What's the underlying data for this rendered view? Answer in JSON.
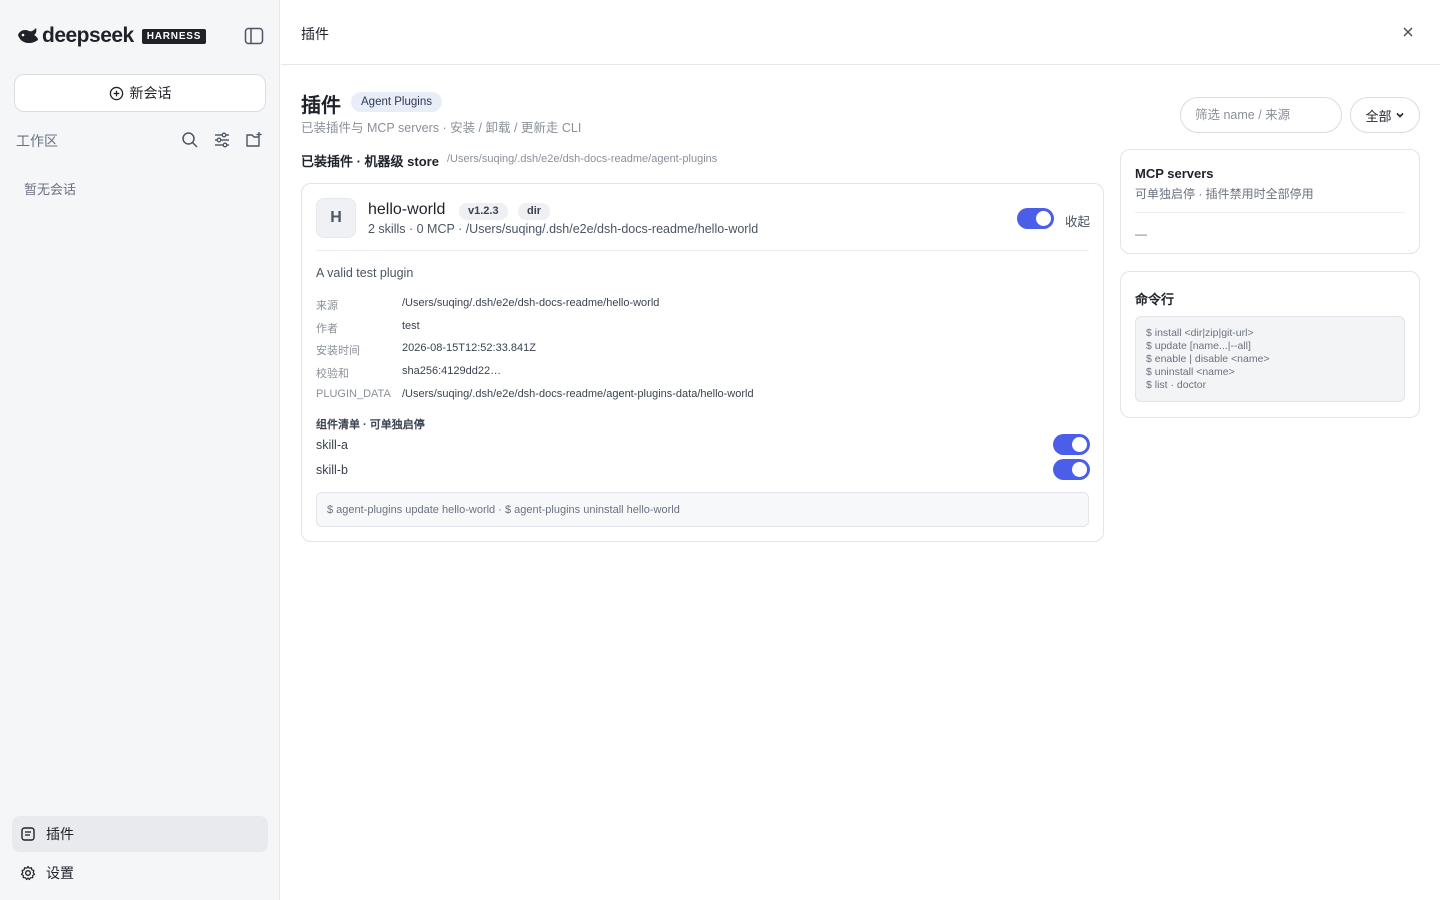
{
  "brand": {
    "name": "deepseek",
    "tag": "HARNESS"
  },
  "sidebar": {
    "new_chat": "新会话",
    "workspace_label": "工作区",
    "empty_text": "暂无会话",
    "nav": [
      {
        "label": "插件",
        "icon": "plugin-icon",
        "active": true
      },
      {
        "label": "设置",
        "icon": "gear-icon",
        "active": false
      }
    ]
  },
  "topbar": {
    "title": "插件"
  },
  "page": {
    "title": "插件",
    "badge": "Agent Plugins",
    "subtitle": "已装插件与 MCP servers · 安装 / 卸载 / 更新走 CLI",
    "filter_placeholder": "筛选 name / 来源",
    "filter_select": "全部",
    "section_label": "已装插件 · 机器级 store",
    "section_path": "/Users/suqing/.dsh/e2e/dsh-docs-readme/agent-plugins"
  },
  "plugin": {
    "avatar": "H",
    "name": "hello-world",
    "version": "v1.2.3",
    "type": "dir",
    "meta": "2 skills · 0 MCP · /Users/suqing/.dsh/e2e/dsh-docs-readme/hello-world",
    "enabled": true,
    "collapse_label": "收起",
    "description": "A valid test plugin",
    "details": [
      {
        "key": "来源",
        "value": "/Users/suqing/.dsh/e2e/dsh-docs-readme/hello-world"
      },
      {
        "key": "作者",
        "value": "test"
      },
      {
        "key": "安装时间",
        "value": "2026-08-15T12:52:33.841Z"
      },
      {
        "key": "校验和",
        "value": "sha256:4129dd22…"
      },
      {
        "key": "PLUGIN_DATA",
        "value": "/Users/suqing/.dsh/e2e/dsh-docs-readme/agent-plugins-data/hello-world"
      }
    ],
    "components_title": "组件清单 · 可单独启停",
    "components": [
      {
        "name": "skill-a",
        "enabled": true
      },
      {
        "name": "skill-b",
        "enabled": true
      }
    ],
    "command": "$ agent-plugins update hello-world · $ agent-plugins uninstall hello-world"
  },
  "mcp_panel": {
    "title": "MCP servers",
    "subtitle": "可单独启停 · 插件禁用时全部停用",
    "empty": "—"
  },
  "cli_panel": {
    "title": "命令行",
    "lines": [
      "$ install <dir|zip|git-url>",
      "$ update [name...|--all]",
      "$ enable | disable <name>",
      "$ uninstall <name>",
      "$ list · doctor"
    ]
  },
  "colors": {
    "accent": "#4a5ee8",
    "sidebar_bg": "#f5f6f8",
    "border": "#e1e4e8"
  }
}
